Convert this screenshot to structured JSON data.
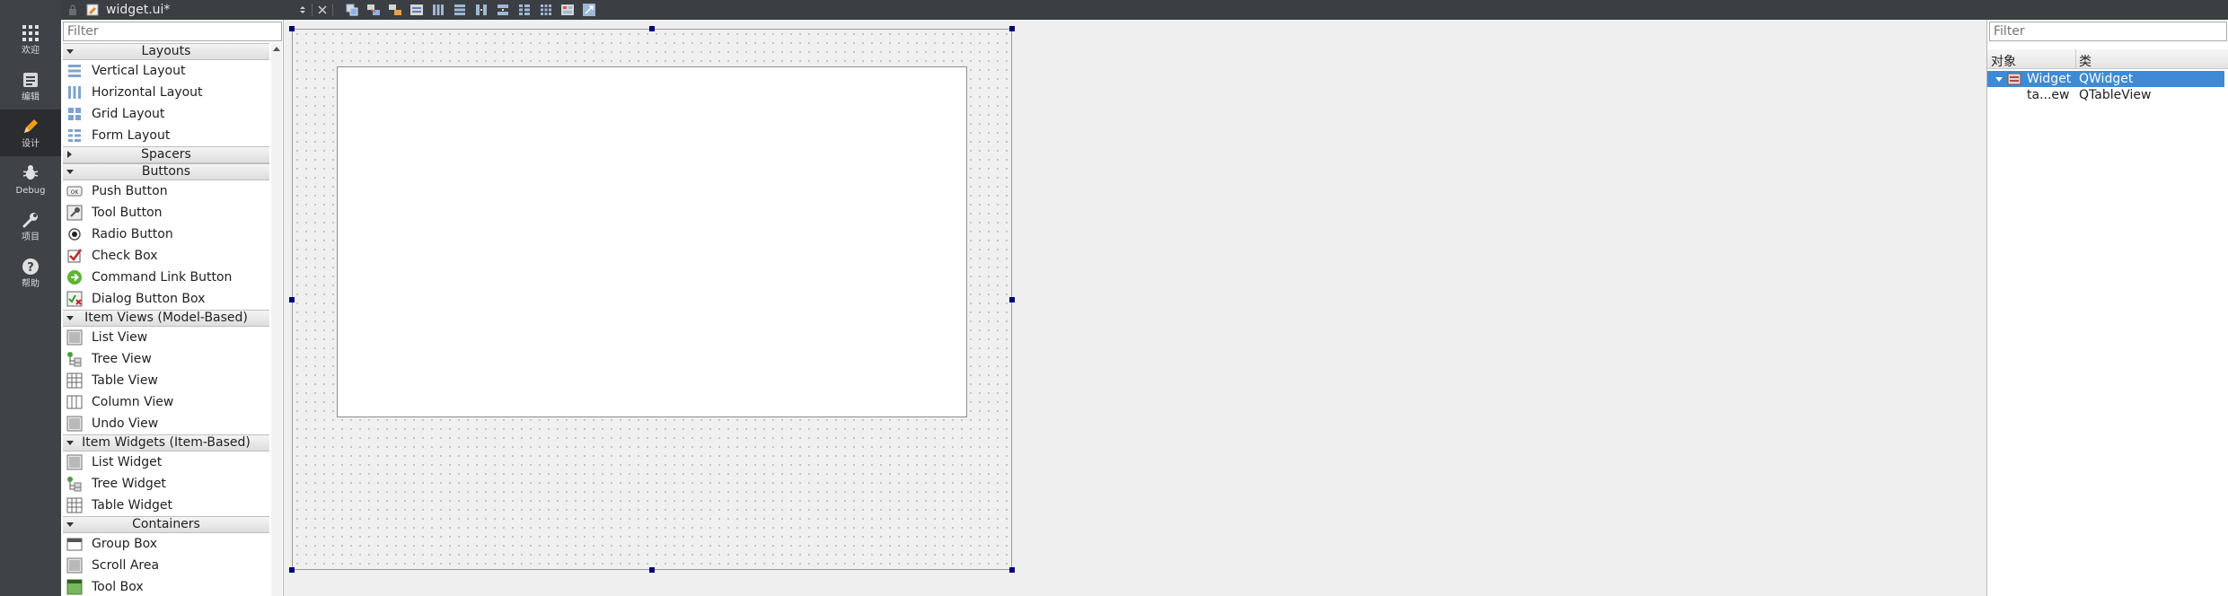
{
  "modebar": {
    "items": [
      {
        "label": "欢迎",
        "icon": "grid-icon"
      },
      {
        "label": "编辑",
        "icon": "document-icon"
      },
      {
        "label": "设计",
        "icon": "pencil-icon"
      },
      {
        "label": "Debug",
        "icon": "bug-icon"
      },
      {
        "label": "项目",
        "icon": "wrench-icon"
      },
      {
        "label": "帮助",
        "icon": "help-icon"
      }
    ]
  },
  "toolbar": {
    "file_name": "widget.ui*"
  },
  "widgetbox": {
    "filter_placeholder": "Filter",
    "categories": {
      "layouts": "Layouts",
      "spacers": "Spacers",
      "buttons": "Buttons",
      "item_views": "Item Views (Model-Based)",
      "item_widgets": "Item Widgets (Item-Based)",
      "containers": "Containers"
    },
    "layouts": [
      "Vertical Layout",
      "Horizontal Layout",
      "Grid Layout",
      "Form Layout"
    ],
    "buttons": [
      "Push Button",
      "Tool Button",
      "Radio Button",
      "Check Box",
      "Command Link Button",
      "Dialog Button Box"
    ],
    "item_views": [
      "List View",
      "Tree View",
      "Table View",
      "Column View",
      "Undo View"
    ],
    "item_widgets": [
      "List Widget",
      "Tree Widget",
      "Table Widget"
    ],
    "containers": [
      "Group Box",
      "Scroll Area",
      "Tool Box"
    ]
  },
  "inspector": {
    "filter_placeholder": "Filter",
    "header": {
      "object": "对象",
      "class": "类"
    },
    "rows": [
      {
        "object": "Widget",
        "class": "QWidget"
      },
      {
        "object": "ta...ew",
        "class": "QTableView"
      }
    ]
  },
  "colors": {
    "selection": "#3e8ad6",
    "handle": "#00007f",
    "modebar_bg": "#3f4246"
  }
}
